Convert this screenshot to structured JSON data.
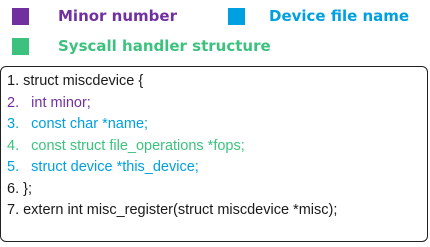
{
  "legend": [
    {
      "label": "Minor number",
      "color": "#7030a0"
    },
    {
      "label": "Device file name",
      "color": "#00a0e0"
    },
    {
      "label": "Syscall handler structure",
      "color": "#3cc27e"
    }
  ],
  "code": {
    "lines": [
      {
        "text": "1. struct miscdevice {",
        "color": "black"
      },
      {
        "text": "2.   int minor;",
        "color": "purple"
      },
      {
        "text": "3.   const char *name;",
        "color": "blue"
      },
      {
        "text": "4.   const struct file_operations *fops;",
        "color": "green"
      },
      {
        "text": "5.   struct device *this_device;",
        "color": "blue"
      },
      {
        "text": "6. };",
        "color": "black"
      },
      {
        "text": "7. extern int misc_register(struct miscdevice *misc);",
        "color": "black"
      }
    ]
  }
}
